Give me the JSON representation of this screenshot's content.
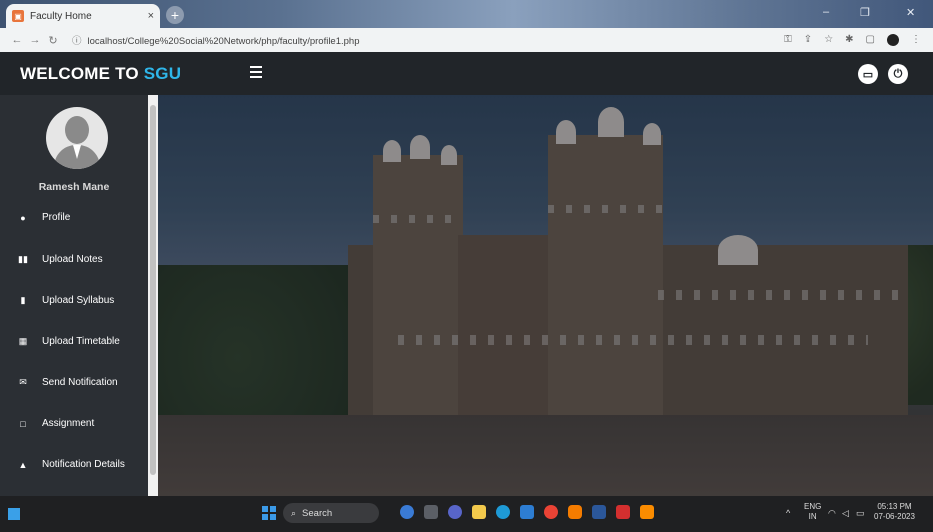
{
  "browser": {
    "tab_title": "Faculty Home",
    "tab_close": "×",
    "new_tab": "+",
    "url": "localhost/College%20Social%20Network/php/faculty/profile1.php",
    "window_controls": [
      "–",
      "❐",
      "✕"
    ]
  },
  "header": {
    "brand_prefix": "WELCOME TO",
    "brand_accent": "SGU",
    "accent_color": "#2fb6e9"
  },
  "sidebar": {
    "user_name": "Ramesh Mane",
    "items": [
      {
        "label": "Profile",
        "icon": "user-circle-icon",
        "glyph": "●"
      },
      {
        "label": "Upload Notes",
        "icon": "book-open-icon",
        "glyph": "▮▮"
      },
      {
        "label": "Upload Syllabus",
        "icon": "book-icon",
        "glyph": "▮"
      },
      {
        "label": "Upload Timetable",
        "icon": "calendar-icon",
        "glyph": "▦"
      },
      {
        "label": "Send Notification",
        "icon": "envelope-icon",
        "glyph": "✉"
      },
      {
        "label": "Assignment",
        "icon": "clipboard-icon",
        "glyph": "□"
      },
      {
        "label": "Notification Details",
        "icon": "bell-icon",
        "glyph": "▲"
      }
    ]
  },
  "taskbar": {
    "search_label": "Search",
    "lang_line1": "ENG",
    "lang_line2": "IN",
    "time": "05:13 PM",
    "date": "07-06-2023"
  }
}
